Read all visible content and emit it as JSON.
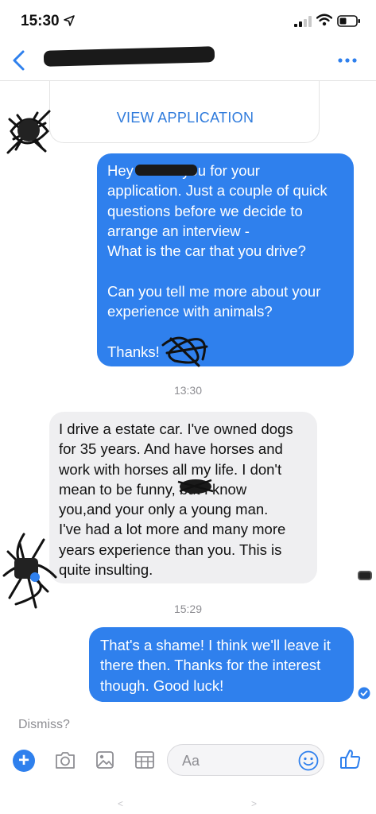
{
  "status_bar": {
    "time": "15:30",
    "icons": [
      "location-arrow-icon",
      "signal-icon",
      "wifi-icon",
      "battery-icon"
    ]
  },
  "header": {
    "back_icon": "chevron-left-icon",
    "contact_name": "",
    "more_icon": "ellipsis-icon"
  },
  "application_card": {
    "link_label": "VIEW APPLICATION"
  },
  "messages": [
    {
      "direction": "outgoing",
      "text": "Hey      Thank you for your\napplication. Just a couple of quick\nquestions before we decide to\narrange an interview -\nWhat is the car that you drive?\n\nCan you tell me more about your\nexperience with animals?\n\nThanks!"
    },
    {
      "direction": "incoming",
      "text": "I drive a estate car. I've owned dogs\nfor 35 years.  And have horses and\nwork with horses all my life. I don't\nmean to be funny,      but I know\nyou,and your only a young man.\nI've had a lot more and many more\nyears experience  than you. This is\nquite insulting."
    },
    {
      "direction": "outgoing",
      "text": "That's a shame! I think we'll leave it\nthere then. Thanks for the interest\nthough. Good luck!"
    }
  ],
  "timestamps": [
    "13:30",
    "15:29"
  ],
  "dismiss_label": "Dismiss?",
  "composer": {
    "placeholder": "Aa",
    "tools": [
      "plus-icon",
      "camera-icon",
      "image-icon",
      "gif-icon"
    ],
    "emoji_icon": "smiley-icon",
    "send_icon": "thumbs-up-icon"
  },
  "bottom_hints": [
    "<",
    ">"
  ],
  "colors": {
    "accent": "#2f80ed",
    "incoming_bubble": "#efeff1",
    "link": "#2f7bdc",
    "muted_text": "#8e8e93"
  }
}
